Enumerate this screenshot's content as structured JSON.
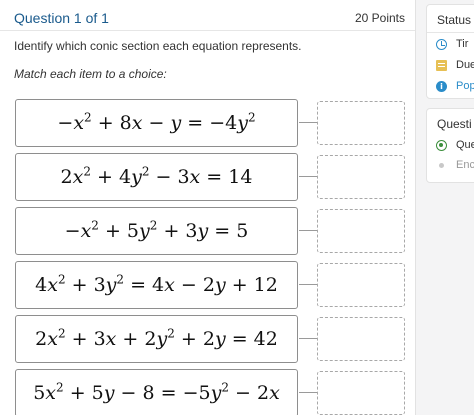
{
  "question": {
    "title": "Question 1 of 1",
    "points": "20 Points",
    "text": "Identify which conic section each equation represents.",
    "instruction": "Match each item to a choice:"
  },
  "items": [
    {
      "equation_html": "&minus;<i>x</i><sup>2</sup> + 8<i>x</i> &minus; <i>y</i> = &minus;4<i>y</i><sup>2</sup>",
      "choice": ""
    },
    {
      "equation_html": "2<i>x</i><sup>2</sup> + 4<i>y</i><sup>2</sup> &minus; 3<i>x</i> = 14",
      "choice": ""
    },
    {
      "equation_html": "&minus;<i>x</i><sup>2</sup> + 5<i>y</i><sup>2</sup> + 3<i>y</i> = 5",
      "choice": ""
    },
    {
      "equation_html": "4<i>x</i><sup>2</sup> + 3<i>y</i><sup>2</sup> = 4<i>x</i> &minus; 2<i>y</i> + 12",
      "choice": ""
    },
    {
      "equation_html": "2<i>x</i><sup>2</sup> + 3<i>x</i> + 2<i>y</i><sup>2</sup> + 2<i>y</i> = 42",
      "choice": ""
    },
    {
      "equation_html": "5<i>x</i><sup>2</sup> + 5<i>y</i> &minus; 8 = &minus;5<i>y</i><sup>2</sup> &minus; 2<i>x</i>",
      "choice": ""
    }
  ],
  "status_panel": {
    "heading": "Status",
    "items": [
      {
        "icon": "clock-icon",
        "label": "Tir",
        "color": "#333333"
      },
      {
        "icon": "calendar-icon",
        "label": "Due",
        "color": "#333333"
      },
      {
        "icon": "info-icon",
        "label": "Pop",
        "color": "#2a8cc9"
      }
    ]
  },
  "question_panel": {
    "heading": "Questi",
    "items": [
      {
        "icon": "radio-icon",
        "label": "Que",
        "color": "#333333"
      },
      {
        "icon": "bullet-icon",
        "label": "Enc",
        "color": "#999999"
      }
    ]
  },
  "colors": {
    "title": "#1a5a8c",
    "accent_blue": "#2a8cc9",
    "accent_green": "#3c8f3c",
    "calendar_yellow": "#e7c055"
  }
}
